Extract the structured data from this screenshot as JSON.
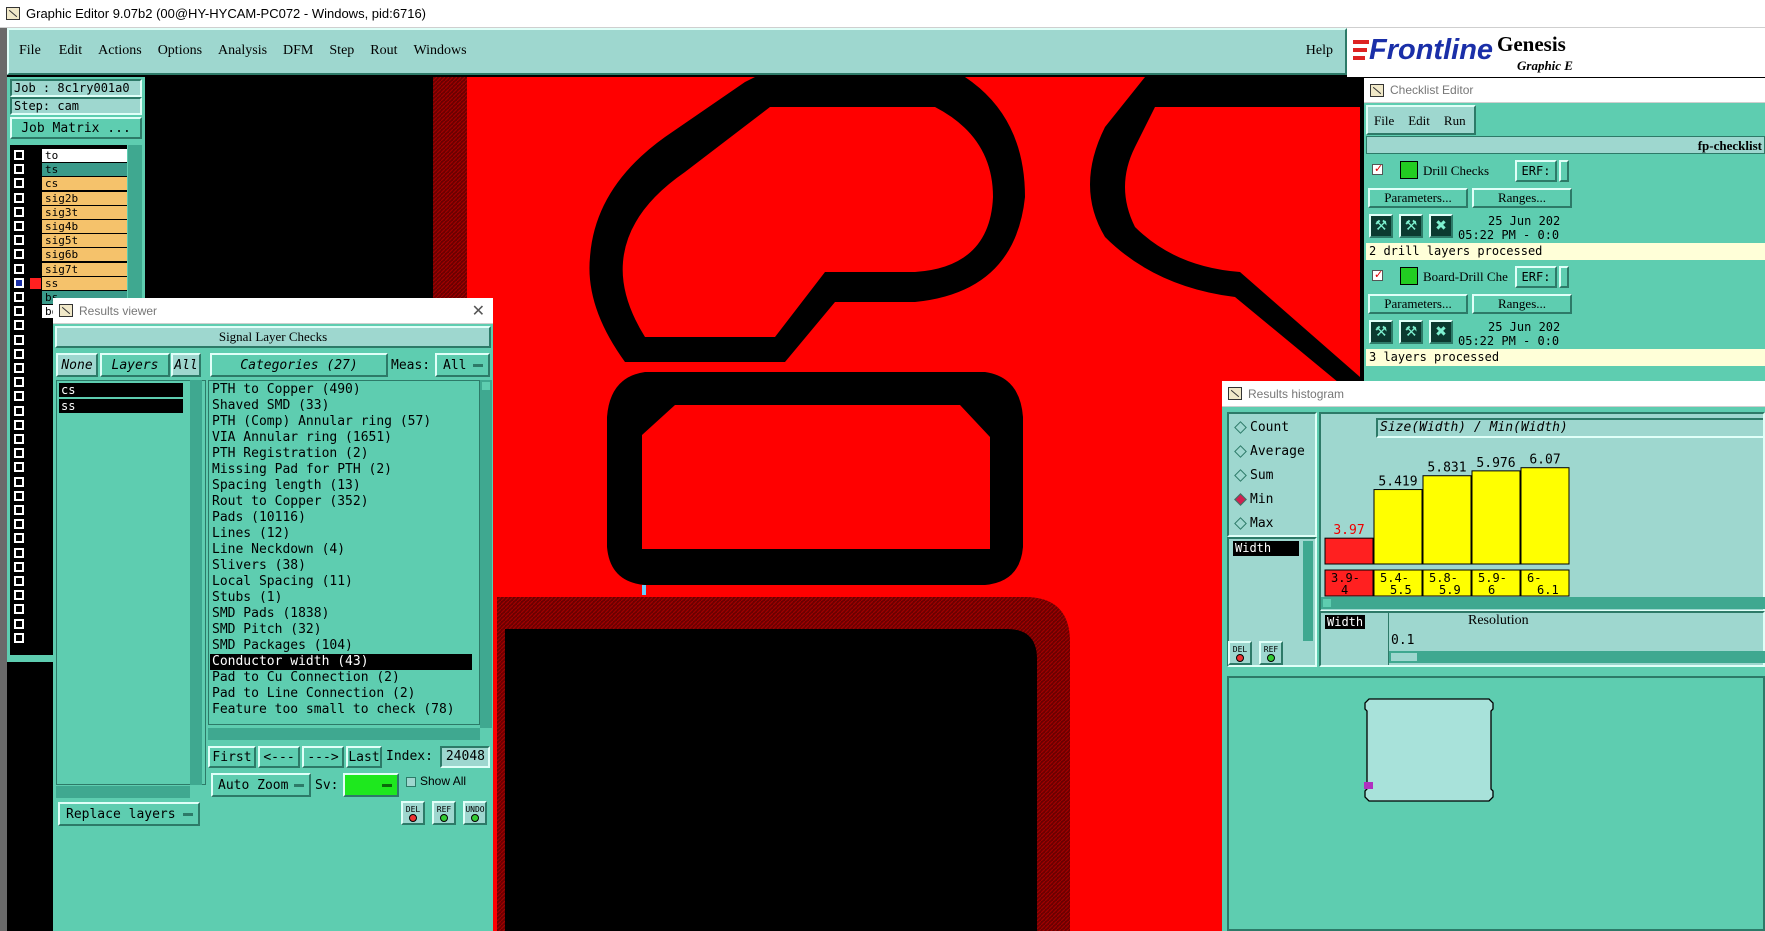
{
  "title_bar": {
    "title": "Graphic Editor 9.07b2 (00@HY-HYCAM-PC072 - Windows, pid:6716)"
  },
  "menubar": {
    "items": [
      "File",
      "Edit",
      "Actions",
      "Options",
      "Analysis",
      "DFM",
      "Step",
      "Rout",
      "Windows"
    ],
    "help": "Help"
  },
  "brand": {
    "logo": "Frontline",
    "product": "Genesis",
    "subtitle": "Graphic E"
  },
  "job_panel": {
    "job": "Job : 8c1ry001a0",
    "step": "Step: cam",
    "matrix_button": "Job Matrix ..."
  },
  "layers": [
    {
      "name": "to",
      "color": "#ffffff"
    },
    {
      "name": "ts",
      "color": "#3a9a8a"
    },
    {
      "name": "cs",
      "color": "#f5c26b"
    },
    {
      "name": "sig2b",
      "color": "#f5c26b"
    },
    {
      "name": "sig3t",
      "color": "#f5c26b"
    },
    {
      "name": "sig4b",
      "color": "#f5c26b"
    },
    {
      "name": "sig5t",
      "color": "#f5c26b"
    },
    {
      "name": "sig6b",
      "color": "#f5c26b"
    },
    {
      "name": "sig7t",
      "color": "#f5c26b"
    },
    {
      "name": "ss",
      "color": "#f5c26b"
    },
    {
      "name": "bs",
      "color": "#3a9a8a"
    },
    {
      "name": "bo",
      "color": "#ffffff"
    }
  ],
  "results_viewer": {
    "title": "Results viewer",
    "heading": "Signal Layer Checks",
    "none_btn": "None",
    "layers_btn": "Layers",
    "all_btn": "All",
    "categories_btn": "Categories (27)",
    "meas_label": "Meas:",
    "meas_value": "All",
    "layer_list": [
      "cs",
      "ss"
    ],
    "categories": [
      "PTH to Copper (490)",
      "Shaved SMD (33)",
      "PTH (Comp) Annular ring (57)",
      "VIA Annular ring (1651)",
      "PTH Registration (2)",
      "Missing Pad for PTH (2)",
      "Spacing length (13)",
      "Rout to Copper (352)",
      "Pads (10116)",
      "Lines (12)",
      "Line Neckdown (4)",
      "Slivers (38)",
      "Local Spacing (11)",
      "Stubs (1)",
      "SMD Pads (1838)",
      "SMD Pitch (32)",
      "SMD Packages (104)",
      "Conductor width (43)",
      "Pad to Cu Connection (2)",
      "Pad to Line Connection (2)",
      "Feature too small to check (78)"
    ],
    "selected_category": "Conductor width (43)",
    "nav": {
      "first": "First",
      "prev": "<---",
      "next": "--->",
      "last": "Last",
      "index_label": "Index:",
      "index_value": "24048"
    },
    "auto_zoom": "Auto Zoom",
    "sv_label": "Sv:",
    "show_all": "Show All",
    "replace_layers": "Replace layers",
    "icon_labels": [
      "DEL",
      "REF",
      "UNDO"
    ]
  },
  "checklist_editor": {
    "title": "Checklist Editor",
    "menu": [
      "File",
      "Edit",
      "Run"
    ],
    "checklist_name": "fp-checklist",
    "checks": [
      {
        "name": "Drill Checks",
        "erf": "ERF:",
        "params": "Parameters...",
        "ranges": "Ranges...",
        "date": "25 Jun 202",
        "time": "05:22 PM - 0:0",
        "status": "2 drill layers processed"
      },
      {
        "name": "Board-Drill Che",
        "erf": "ERF:",
        "params": "Parameters...",
        "ranges": "Ranges...",
        "date": "25 Jun 202",
        "time": "05:22 PM - 0:0",
        "status": "3 layers processed"
      }
    ]
  },
  "results_histogram": {
    "title": "Results histogram",
    "options": [
      "Count",
      "Average",
      "Sum",
      "Min",
      "Max"
    ],
    "selected_option": "Min",
    "measure_list": [
      "Width"
    ],
    "header": "Size(Width) / Min(Width)",
    "resolution_label": "Resolution",
    "resolution_value": "0.1",
    "res_field_label": "Width",
    "icon_labels": [
      "DEL",
      "REF"
    ],
    "colors": {
      "low": "#ff2020",
      "ok": "#ffff00"
    }
  },
  "chart_data": {
    "type": "bar",
    "categories": [
      "3.9-4",
      "5.4-5.5",
      "5.8-5.9",
      "5.9-6",
      "6-6.1"
    ],
    "values": [
      3.97,
      5.419,
      5.831,
      5.976,
      6.07
    ],
    "value_labels": [
      "3.97",
      "5.419",
      "5.831",
      "5.976",
      "6.07"
    ],
    "category_labels": [
      [
        "3.9-",
        "4"
      ],
      [
        "5.4-",
        "5.5"
      ],
      [
        "5.8-",
        "5.9"
      ],
      [
        "5.9-",
        "6"
      ],
      [
        "6-",
        "6.1"
      ]
    ],
    "title": "Size(Width) / Min(Width)",
    "xlabel": "",
    "ylabel": "",
    "ylim": [
      3.2,
      6.3
    ]
  }
}
